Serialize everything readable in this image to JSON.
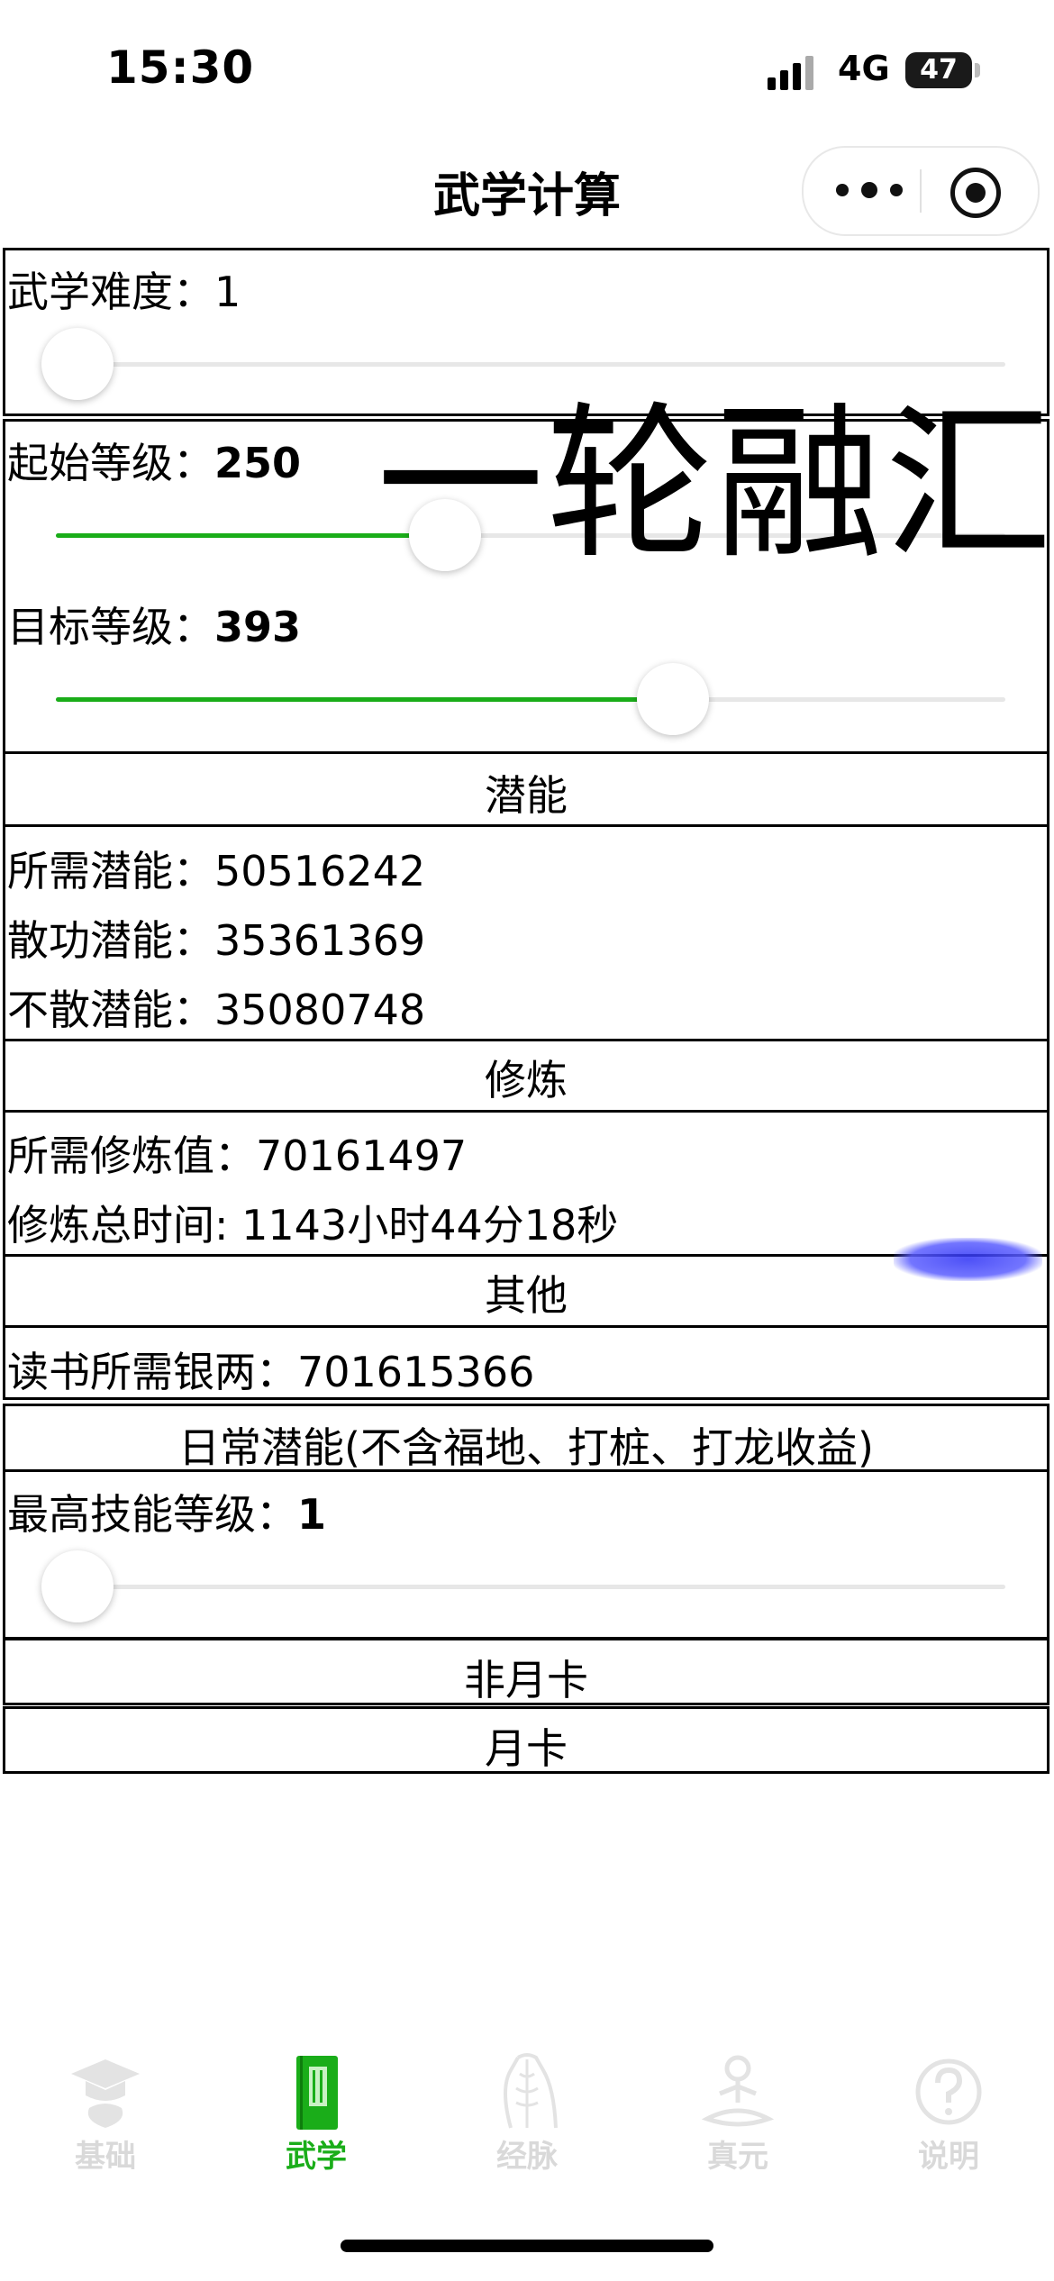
{
  "status": {
    "time": "15:30",
    "network": "4G",
    "battery": "47"
  },
  "nav": {
    "title": "武学计算"
  },
  "difficulty": {
    "label": "武学难度：",
    "value": "1",
    "slider_fraction": 0.0
  },
  "levels": {
    "start_label": "起始等级：",
    "start_value": "250",
    "start_fraction": 0.41,
    "target_label": "目标等级：",
    "target_value": "393",
    "target_fraction": 0.65
  },
  "overlay_text": "一轮融汇",
  "potential": {
    "header": "潜能",
    "needed_label": "所需潜能：",
    "needed_value": "50516242",
    "dispersed_label": "散功潜能：",
    "dispersed_value": "35361369",
    "undispersed_label": "不散潜能：",
    "undispersed_value": "35080748"
  },
  "training": {
    "header": "修炼",
    "needed_label": "所需修炼值：",
    "needed_value": "70161497",
    "time_label": "修炼总时间: ",
    "time_value": "1143小时44分18秒"
  },
  "other": {
    "header": "其他",
    "silver_label": "读书所需银两：",
    "silver_value": "701615366"
  },
  "daily": {
    "header": "日常潜能(不含福地、打桩、打龙收益)",
    "max_level_label": "最高技能等级：",
    "max_level_value": "1",
    "max_level_fraction": 0.0,
    "non_monthly": "非月卡",
    "monthly": "月卡"
  },
  "tabs": [
    {
      "label": "基础",
      "icon": "scholar-cap-icon",
      "active": false
    },
    {
      "label": "武学",
      "icon": "book-icon",
      "active": true
    },
    {
      "label": "经脉",
      "icon": "meridian-body-icon",
      "active": false
    },
    {
      "label": "真元",
      "icon": "meditation-icon",
      "active": false
    },
    {
      "label": "说明",
      "icon": "help-icon",
      "active": false
    }
  ],
  "colors": {
    "accent": "#1aad19",
    "inactive_tab": "#d9d9d9",
    "track": "#e7e7e7"
  }
}
